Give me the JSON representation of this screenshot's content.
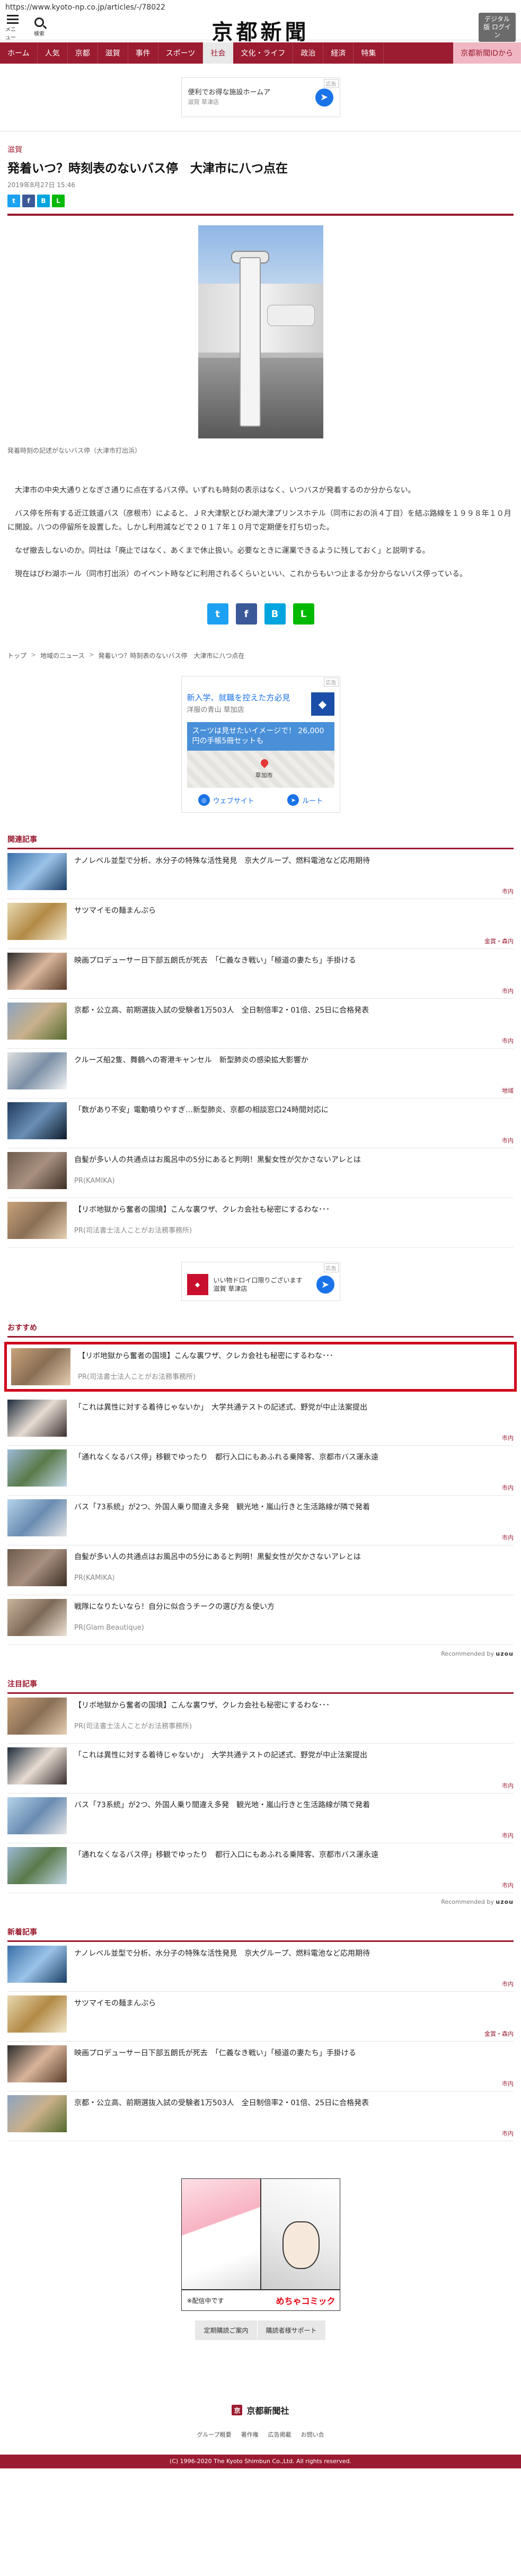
{
  "url": "https://www.kyoto-np.co.jp/articles/-/78022",
  "header": {
    "menu_label": "メニュー",
    "search_label": "検索",
    "logo": "京都新聞",
    "digital_button": "デジタル版 ログイン"
  },
  "nav": {
    "items": [
      "ホーム",
      "人気",
      "京都",
      "滋賀",
      "事件",
      "スポーツ",
      "社会",
      "文化・ライフ",
      "政治",
      "経済",
      "特集"
    ],
    "active": "社会",
    "member": "京都新聞IDから"
  },
  "top_ad": {
    "tag": "広告",
    "line1": "便利でお得な施設ホームア",
    "line2": "滋賀 草津店"
  },
  "article": {
    "category": "滋賀",
    "title": "発着いつ？時刻表のないバス停　大津市に八つ点在",
    "date": "2019年8月27日 15:46",
    "caption": "発着時刻の記述がないバス停（大津市打出浜）",
    "paragraphs": [
      "大津市の中央大通りとなぎさ通りに点在するバス停。いずれも時刻の表示はなく、いつバスが発着するのか分からない。",
      "バス停を所有する近江鉄道バス（彦根市）によると、ＪＲ大津駅とびわ湖大津プリンスホテル（同市におの浜４丁目）を結ぶ路線を１９９８年１０月に開設。八つの停留所を設置した。しかし利用減などで２０１７年１０月で定期便を打ち切った。",
      "なぜ撤去しないのか。同社は「廃止ではなく、あくまで休止扱い。必要なときに運業できるように残しておく」と説明する。",
      "現在はびわ湖ホール（同市打出浜）のイベント時などに利用されるくらいといい、これからもいつ止まるか分からないバス停っている。"
    ]
  },
  "breadcrumb": [
    "トップ",
    "地域のニュース",
    "発着いつ？時刻表のないバス停　大津市に八つ点在"
  ],
  "mid_ad": {
    "tag": "広告",
    "headline": "新入学、就職を控えた方必見",
    "location": "洋服の青山 草加店",
    "promo": "スーツは見せたいイメージで！ 26,000円の手帳5冊セットも",
    "map_label": "草加市",
    "website_btn": "ウェブサイト",
    "route_btn": "ルート"
  },
  "related": {
    "title": "関連記事",
    "items": [
      {
        "text": "ナノレベル並型で分析、水分子の特殊な活性発見　京大グループ、燃料電池など応用期待",
        "cat": "市内"
      },
      {
        "text": "サツマイモの麺まんぷら",
        "cat": "金賞・森内"
      },
      {
        "text": "映画プロデューサー日下部五朗氏が死去　「仁義なき戦い」「極道の妻たち」手掛ける",
        "cat": "市内"
      },
      {
        "text": "京都・公立高、前期選抜入試の受験者1万503人　全日制倍率2・01倍、25日に合格発表",
        "cat": "市内"
      },
      {
        "text": "クルーズ船2隻、舞鶴への寄港キャンセル　新型肺炎の感染拡大影響か",
        "cat": "地域"
      },
      {
        "text": "「数があり不安」電動噴りやすぎ…新型肺炎、京都の相談窓口24時間対応に",
        "cat": "市内"
      },
      {
        "text": "自髪が多い人の共通点はお風呂中の5分にあると判明！黒髪女性が欠かさないアレとは",
        "pr": "PR(KAMIKA)"
      },
      {
        "text": "【リボ地獄から奮者の国境】こんな裏ワザ、クレカ会社も秘密にするわな･･･",
        "pr": "PR(司法書士法人ことがお法務事務所)"
      }
    ]
  },
  "small_ad": {
    "tag": "広告",
    "line1": "いい物ドロイ口限りございます",
    "line2": "滋賀 草津店"
  },
  "recommended": {
    "title": "おすすめ",
    "items": [
      {
        "text": "【リボ地獄から奮者の国境】こんな裏ワザ、クレカ会社も秘密にするわな･･･",
        "pr": "PR(司法書士法人ことがお法務事務所)"
      },
      {
        "text": "「これは異性に対する着待じゃないか」　大学共通テストの記述式、野党が中止法案提出",
        "cat": "市内"
      },
      {
        "text": "「通れなくなるバス停」移観でゆったり　都行入口にもあふれる乗降客、京都市バス運永遠",
        "cat": "市内"
      },
      {
        "text": "バス「73系統」が2つ、外国人乗り間違え多発　観光地・嵐山行きと生活路線が隣で発着",
        "cat": "市内"
      },
      {
        "text": "自髪が多い人の共通点はお風呂中の5分にあると判明！黒髪女性が欠かさないアレとは",
        "pr": "PR(KAMIKA)"
      },
      {
        "text": "戦隊になりたいなら！自分に似合うチークの選び方＆使い方",
        "pr": "PR(Glam Beautique)"
      }
    ],
    "by": "Recommended by"
  },
  "featured": {
    "title": "注目記事",
    "items": [
      {
        "text": "【リボ地獄から奮者の国境】こんな裏ワザ、クレカ会社も秘密にするわな･･･",
        "pr": "PR(司法書士法人ことがお法務事務所)"
      },
      {
        "text": "「これは異性に対する着待じゃないか」　大学共通テストの記述式、野党が中止法案提出",
        "cat": "市内"
      },
      {
        "text": "バス「73系統」が2つ、外国人乗り間違え多発　観光地・嵐山行きと生活路線が隣で発着",
        "cat": "市内"
      },
      {
        "text": "「通れなくなるバス停」移観でゆったり　都行入口にもあふれる乗降客、京都市バス運永遠",
        "cat": "市内"
      }
    ],
    "by": "Recommended by"
  },
  "new": {
    "title": "新着記事",
    "items": [
      {
        "text": "ナノレベル並型で分析、水分子の特殊な活性発見　京大グループ、燃料電池など応用期待",
        "cat": "市内"
      },
      {
        "text": "サツマイモの麺まんぷら",
        "cat": "金賞・森内"
      },
      {
        "text": "映画プロデューサー日下部五朗氏が死去　「仁義なき戦い」「極道の妻たち」手掛ける",
        "cat": "市内"
      },
      {
        "text": "京都・公立高、前期選抜入試の受験者1万503人　全日制倍率2・01倍、25日に合格発表",
        "cat": "市内"
      }
    ]
  },
  "manga_ad": {
    "brand": "めちゃコミック",
    "note": "※配信中です"
  },
  "foot_links": [
    "定期購読ご案内",
    "購読者様サポート"
  ],
  "footer": {
    "logo": "京都新聞社",
    "links": [
      "グループ概要",
      "著作権",
      "広告掲載",
      "お問い合"
    ],
    "copyright": "(C) 1996-2020 The Kyoto Shimbun Co.,Ltd. All rights reserved."
  }
}
